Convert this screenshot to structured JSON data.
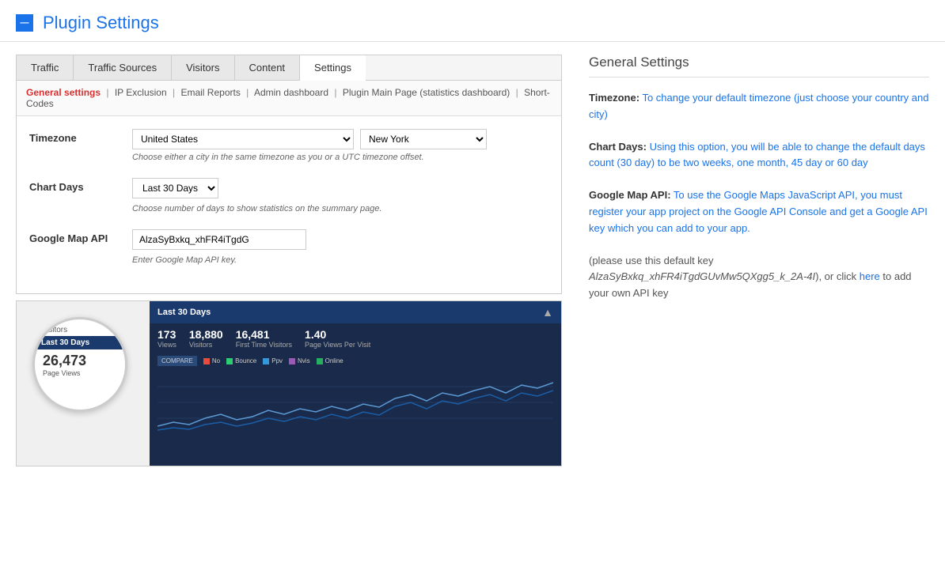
{
  "header": {
    "icon_label": "—",
    "title": "Plugin Settings"
  },
  "tabs": [
    {
      "id": "traffic",
      "label": "Traffic",
      "active": false
    },
    {
      "id": "traffic-sources",
      "label": "Traffic Sources",
      "active": false
    },
    {
      "id": "visitors",
      "label": "Visitors",
      "active": false
    },
    {
      "id": "content",
      "label": "Content",
      "active": false
    },
    {
      "id": "settings",
      "label": "Settings",
      "active": true
    }
  ],
  "sub_nav": [
    {
      "id": "general",
      "label": "General settings",
      "active": true
    },
    {
      "id": "ip",
      "label": "IP Exclusion",
      "active": false
    },
    {
      "id": "email",
      "label": "Email Reports",
      "active": false
    },
    {
      "id": "admin",
      "label": "Admin dashboard",
      "active": false
    },
    {
      "id": "plugin-main",
      "label": "Plugin Main Page (statistics dashboard)",
      "active": false
    },
    {
      "id": "short-codes",
      "label": "Short-Codes",
      "active": false
    }
  ],
  "settings": {
    "timezone": {
      "label": "Timezone",
      "country_value": "United States",
      "city_value": "New York",
      "hint": "Choose either a city in the same timezone as you or a UTC timezone offset."
    },
    "chart_days": {
      "label": "Chart Days",
      "value": "Last 30 Days",
      "hint": "Choose number of days to show statistics on the summary page."
    },
    "google_map_api": {
      "label": "Google Map API",
      "value": "AlzaSyBxkq_xhFR4iTgdG",
      "hint": "Enter Google Map API key."
    }
  },
  "preview": {
    "magnifier": {
      "visitors_label": "visitors",
      "last30_label": "Last 30 Days",
      "number": "26,473",
      "page_views_label": "Page Views"
    },
    "dashboard": {
      "title": "Last 30 Days",
      "close_btn": "▲",
      "stats": [
        {
          "num": "173",
          "label": "Views"
        },
        {
          "num": "18,880",
          "label": "Visitors"
        },
        {
          "num": "16,481",
          "label": "First Time Visitors"
        },
        {
          "num": "1.40",
          "label": "Page Views Per Visit"
        }
      ],
      "legend_compare": "COMPARE",
      "legend_items": [
        {
          "color": "#e74c3c",
          "label": "No"
        },
        {
          "color": "#2ecc71",
          "label": "Bounce"
        },
        {
          "color": "#3498db",
          "label": "Ppv"
        },
        {
          "color": "#9b59b6",
          "label": "Nvis"
        },
        {
          "color": "#27ae60",
          "label": "Online"
        }
      ]
    }
  },
  "right_panel": {
    "title": "General Settings",
    "sections": [
      {
        "id": "timezone",
        "label": "Timezone:",
        "text": " To change your default timezone (just choose your country and city)"
      },
      {
        "id": "chart-days",
        "label": "Chart Days:",
        "text": " Using this option, you will be able to change the default days count (30 day) to be two weeks, one month, 45 day or 60 day"
      },
      {
        "id": "google-map",
        "label": "Google Map API:",
        "text": " To use the Google Maps JavaScript API, you must register your app project on the Google API Console and get a Google API key which you can add to your app."
      },
      {
        "id": "default-key",
        "prefix": "(please use this default key ",
        "key": "AlzaSyBxkq_xhFR4iTgdGUvMw5QXgg5_k_2A-4I",
        "middle": "), or click ",
        "link": "here",
        "suffix": " to add your own API key"
      }
    ]
  }
}
